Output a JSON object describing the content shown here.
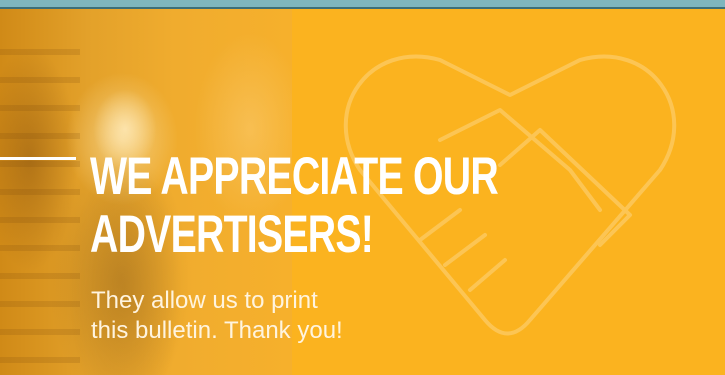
{
  "banner": {
    "headline_line1": "WE APPRECIATE OUR",
    "headline_line2": "ADVERTISERS!",
    "subtext_line1": "They allow us to print",
    "subtext_line2": "this bulletin. Thank you!",
    "background_color": "#fbb31f",
    "top_border_color": "#7fb6bd",
    "text_color": "#ffffff",
    "decorative_icon": "handshake-icon",
    "photo": "woman-behind-counter-photo"
  }
}
